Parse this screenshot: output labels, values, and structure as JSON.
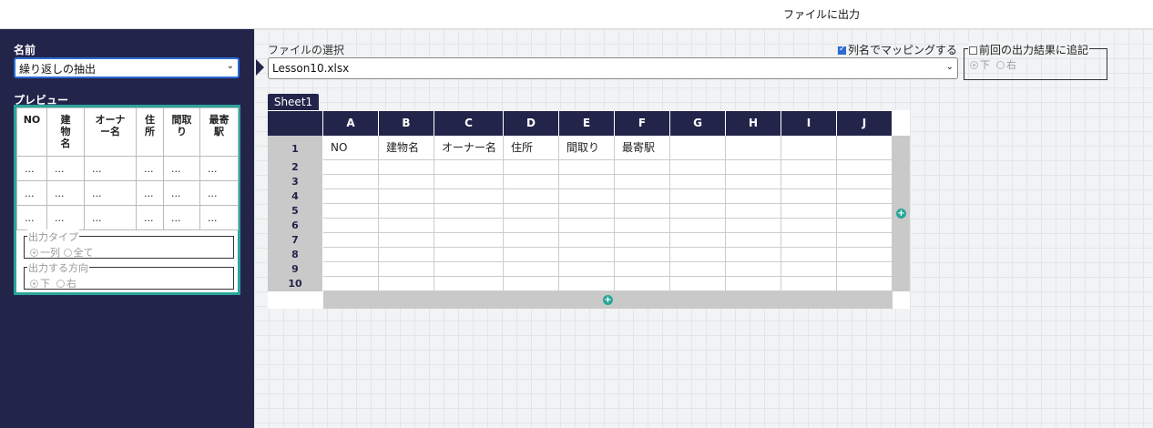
{
  "topbar": {
    "title": "ファイルに出力"
  },
  "sidebar": {
    "name_label": "名前",
    "name_value": "繰り返しの抽出",
    "preview_label": "プレビュー",
    "preview_headers": [
      "NO",
      "建物名",
      "オーナー名",
      "住所",
      "間取り",
      "最寄駅"
    ],
    "preview_cell": "...",
    "output_type": {
      "legend": "出力タイプ",
      "opt1": "一列",
      "opt2": "全て"
    },
    "output_dir": {
      "legend": "出力する方向",
      "opt1": "下",
      "opt2": "右"
    }
  },
  "main": {
    "file_label": "ファイルの選択",
    "file_value": "Lesson10.xlsx",
    "map_label": "列名でマッピングする",
    "append": {
      "legend": "前回の出力結果に追記",
      "opt1": "下",
      "opt2": "右"
    },
    "sheet_tab": "Sheet1",
    "columns": [
      "A",
      "B",
      "C",
      "D",
      "E",
      "F",
      "G",
      "H",
      "I",
      "J"
    ],
    "rows": [
      "1",
      "2",
      "3",
      "4",
      "5",
      "6",
      "7",
      "8",
      "9",
      "10"
    ],
    "row1": [
      "NO",
      "建物名",
      "オーナー名",
      "住所",
      "間取り",
      "最寄駅",
      "",
      "",
      "",
      ""
    ],
    "plus": "+"
  },
  "colors": {
    "navy": "#23244a",
    "teal": "#2aa59a",
    "blue": "#2b6cd6"
  }
}
